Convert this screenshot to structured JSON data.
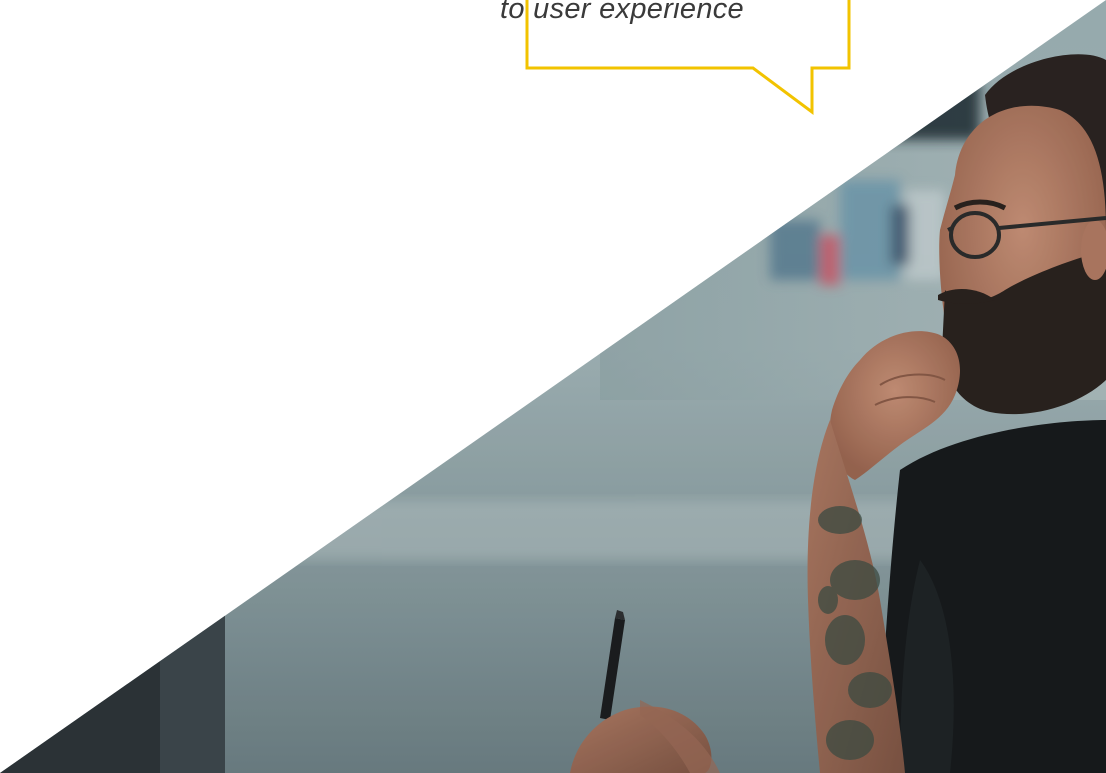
{
  "speech_bubble": {
    "text": "to user experience",
    "border_color": "#f2c300"
  },
  "hero_image": {
    "subject": "bearded man with glasses and tattooed forearm thinking, holding a pen, blurred office background"
  },
  "colors": {
    "background": "#ffffff",
    "accent": "#f2c300",
    "text": "#3a3a3a"
  }
}
